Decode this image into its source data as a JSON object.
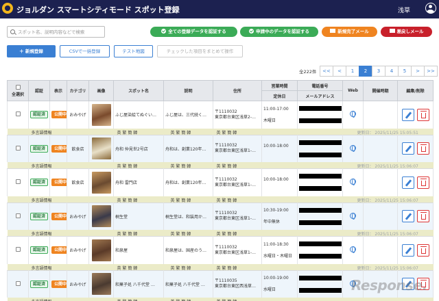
{
  "header": {
    "title": "ジョルダン スマートシティモード スポット登録",
    "user": "浅草"
  },
  "search": {
    "placeholder": "スポット名、説明内容などで検索"
  },
  "filters": {
    "all_registered": "全ての登録データを認証する",
    "applying": "申請中のデータを認証する",
    "new_complete_mail": "新規完了メール",
    "return_mail": "差戻しメール"
  },
  "toolbar": {
    "new_label": "＋ 新規登録",
    "csv_label": "CSVで一括登録",
    "map_label": "テスト地図",
    "bulk_label": "チェックした項目をまとめて操作"
  },
  "total": "全222件",
  "pager": [
    "<<",
    "<",
    "1",
    "2",
    "3",
    "4",
    "5",
    ">",
    ">>"
  ],
  "pager_active": "2",
  "columns": {
    "select_all": "全選択",
    "auth": "認証",
    "display": "表示",
    "category": "カテゴリ",
    "image": "画像",
    "name": "スポット名",
    "desc": "説明",
    "address": "住所",
    "hours": "営業時間",
    "holiday": "定休日",
    "phone": "電話番号",
    "email": "メールアドレス",
    "web": "Web",
    "period": "開催時期",
    "edit": "編集/削除"
  },
  "rows": [
    {
      "auth": "認証済",
      "display": "公開中",
      "category": "おみやげ",
      "name": "ふじ屋染絵てぬぐい…",
      "desc": "ふじ屋は、三代続く…",
      "zip": "〒1110032",
      "addr": "東京都台東区浅草2-…",
      "hours": "11:00-17:00",
      "holiday": "木曜日",
      "updated": "更新日： 2025/11/25 15:05:51",
      "img": [
        "#7a4a2c",
        "#d6b48a"
      ]
    },
    {
      "auth": "認証済",
      "display": "公開中",
      "category": "飲食店",
      "name": "舟和 仲見世2号店",
      "desc": "舟和は、創業120年…",
      "zip": "〒1110032",
      "addr": "東京都台東区浅草1-…",
      "hours": "10:00-18:00",
      "holiday": "",
      "updated": "更新日： 2025/11/25 15:06:07",
      "img": [
        "#e8e0c8",
        "#8a6a3a"
      ]
    },
    {
      "auth": "認証済",
      "display": "公開中",
      "category": "飲食店",
      "name": "舟和 雷門店",
      "desc": "舟和は、創業120年…",
      "zip": "〒1110032",
      "addr": "東京都台東区浅草1-…",
      "hours": "10:00-18:00",
      "holiday": "",
      "updated": "更新日： 2025/11/25 15:06:07",
      "img": [
        "#6a4a30",
        "#c89a60"
      ]
    },
    {
      "auth": "認証済",
      "display": "公開中",
      "category": "おみやげ",
      "name": "桐生堂",
      "desc": "桐生堂は、和装用か…",
      "zip": "〒1110032",
      "addr": "東京都台東区浅草1-…",
      "hours": "10:30-19:00",
      "holiday": "年中無休",
      "updated": "更新日： 2025/11/25 15:06:07",
      "img": [
        "#3a3a4a",
        "#b08a5a"
      ]
    },
    {
      "auth": "認証済",
      "display": "公開中",
      "category": "おみやげ",
      "name": "和泉屋",
      "desc": "和泉屋は、国産のう…",
      "zip": "〒1110032",
      "addr": "東京都台東区浅草1-…",
      "hours": "11:00-18:30",
      "holiday": "水曜日・木曜日",
      "updated": "更新日： 2025/11/25 15:06:07",
      "img": [
        "#5a3a28",
        "#a07850"
      ]
    },
    {
      "auth": "認証済",
      "display": "公開中",
      "category": "おみやげ",
      "name": "和菓子処 八千代堂 …",
      "desc": "和菓子処 八千代堂 …",
      "zip": "〒1110035",
      "addr": "東京都台東区西浅草…",
      "hours": "10:00-19:00",
      "holiday": "水曜日",
      "updated": "",
      "img": [
        "#4a3a30",
        "#9a7a5a"
      ]
    }
  ],
  "multilang": {
    "label": "多言語情報",
    "langs": "英 繁 簡 韓"
  },
  "watermark": "Response."
}
